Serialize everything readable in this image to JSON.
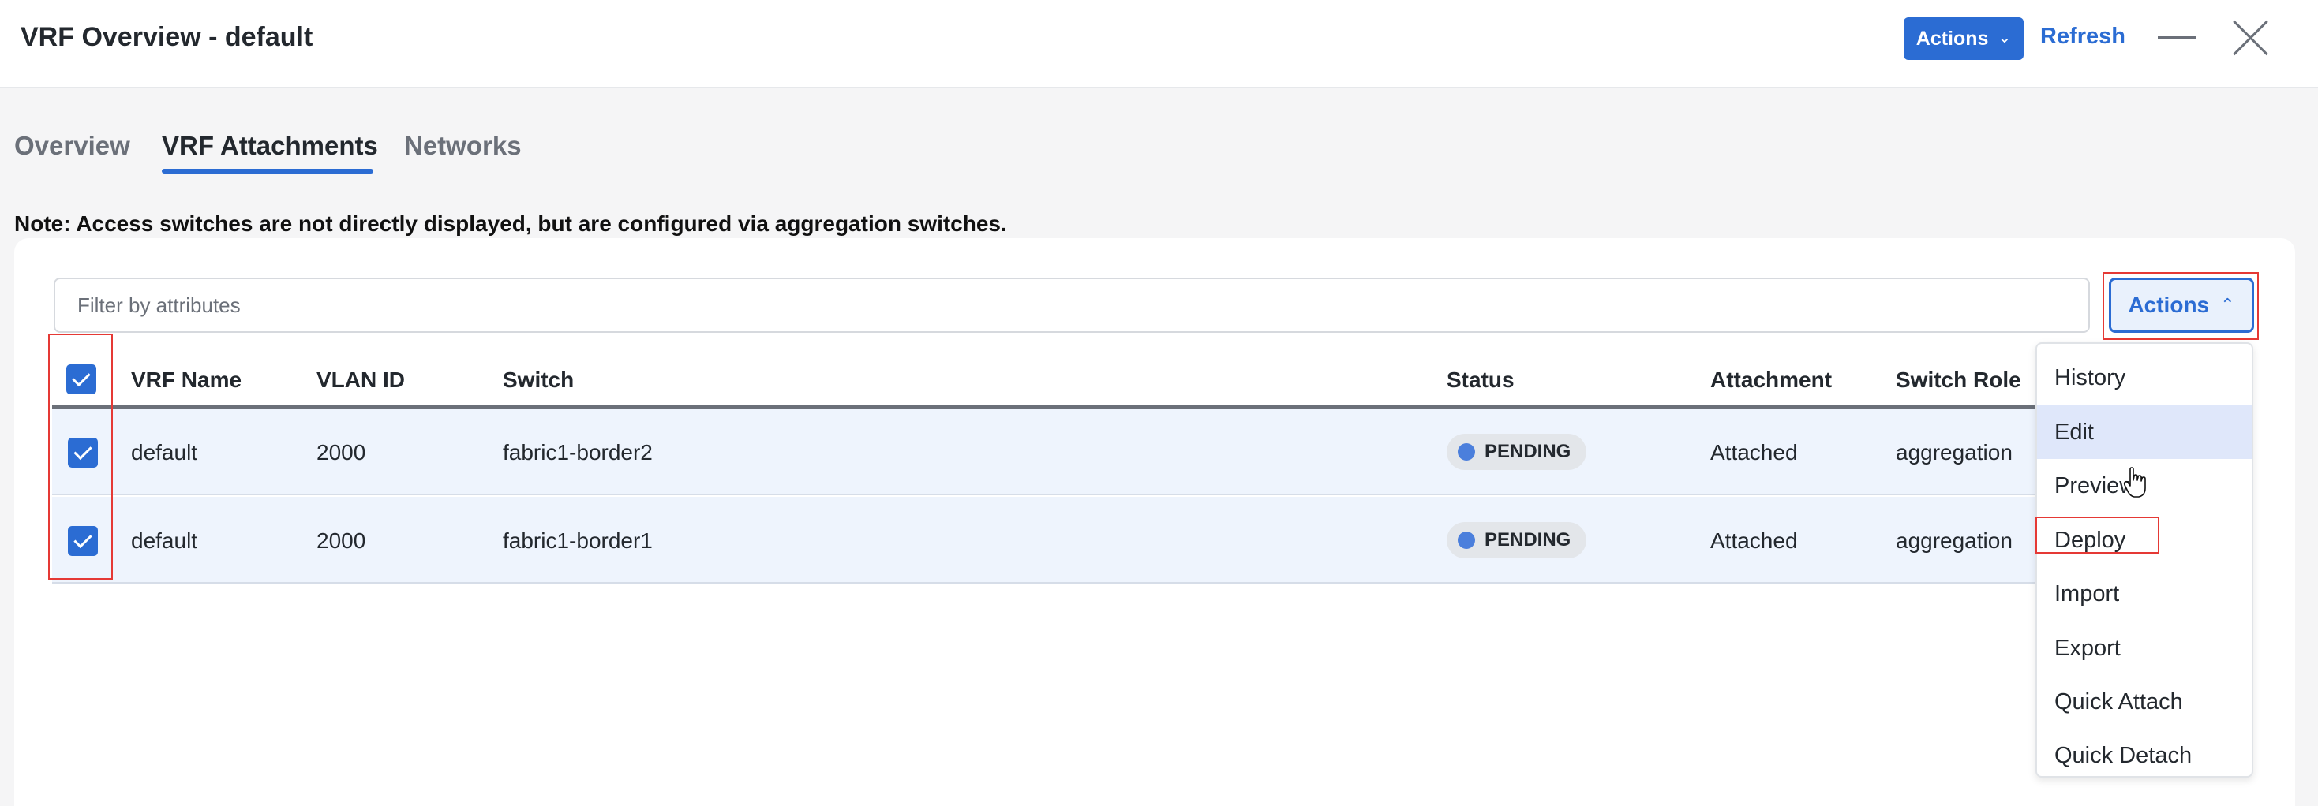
{
  "header": {
    "title": "VRF Overview - default",
    "actions_label": "Actions",
    "refresh_label": "Refresh"
  },
  "tabs": [
    {
      "label": "Overview",
      "active": false
    },
    {
      "label": "VRF Attachments",
      "active": true
    },
    {
      "label": "Networks",
      "active": false
    }
  ],
  "note": "Note: Access switches are not directly displayed, but are configured via aggregation switches.",
  "filter": {
    "placeholder": "Filter by attributes",
    "value": ""
  },
  "card_actions_label": "Actions",
  "table": {
    "columns": [
      "VRF Name",
      "VLAN ID",
      "Switch",
      "Status",
      "Attachment",
      "Switch Role"
    ],
    "select_all_checked": true,
    "rows": [
      {
        "checked": true,
        "vrf_name": "default",
        "vlan_id": "2000",
        "switch": "fabric1-border2",
        "status": "PENDING",
        "attachment": "Attached",
        "switch_role": "aggregation"
      },
      {
        "checked": true,
        "vrf_name": "default",
        "vlan_id": "2000",
        "switch": "fabric1-border1",
        "status": "PENDING",
        "attachment": "Attached",
        "switch_role": "aggregation"
      }
    ]
  },
  "actions_menu": {
    "items": [
      "History",
      "Edit",
      "Preview",
      "Deploy",
      "Import",
      "Export",
      "Quick Attach",
      "Quick Detach"
    ],
    "hovered": "Edit",
    "highlighted": "Deploy"
  },
  "colors": {
    "accent": "#2b6cd3",
    "highlight_box": "#e53935",
    "status_dot": "#4b7fdc",
    "row_selected_bg": "#eef4fd"
  },
  "icons": [
    "chevron-down-icon",
    "chevron-up-icon",
    "minimize-icon",
    "close-icon",
    "checkbox-checked-icon",
    "status-dot-icon",
    "hand-cursor-icon"
  ]
}
